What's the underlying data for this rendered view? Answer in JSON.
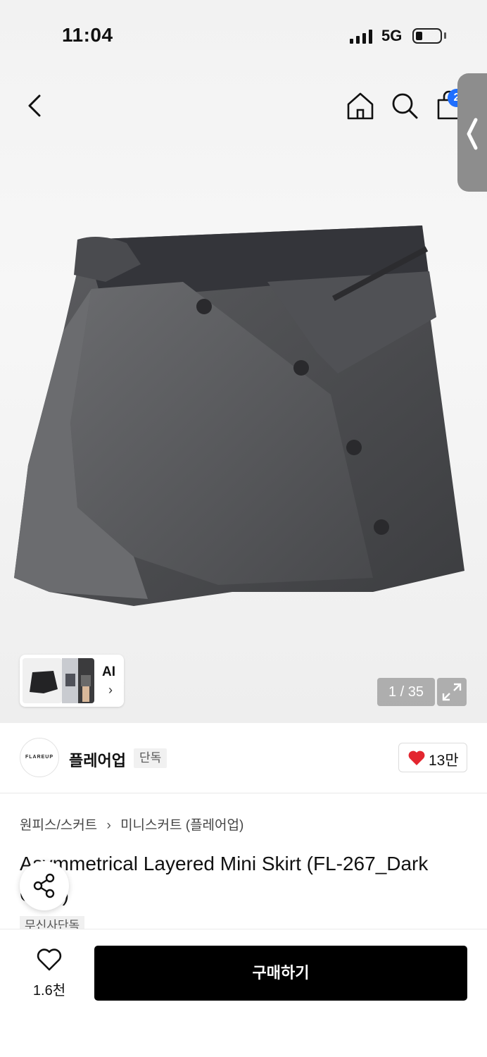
{
  "status_bar": {
    "time": "11:04",
    "network": "5G"
  },
  "nav": {
    "cart_count": "2"
  },
  "gallery": {
    "ai_label": "AI",
    "ai_chevron": "›",
    "counter": "1 / 35"
  },
  "brand": {
    "logo_text": "FLAREUP",
    "name": "플레어업",
    "tag": "단독",
    "likes": "13만"
  },
  "breadcrumb": {
    "category": "원피스/스커트",
    "separator": "›",
    "subcategory": "미니스커트 (플레어업)"
  },
  "product": {
    "title": "Asymmetrical Layered Mini Skirt (FL-267_Dark Gray)",
    "badge": "무신사단독"
  },
  "bottom_bar": {
    "wish_count": "1.6천",
    "buy_label": "구매하기"
  },
  "colors": {
    "accent_blue": "#1f6fff",
    "heart_red": "#e3262f",
    "buy_button": "#000000"
  },
  "icons": [
    "back-arrow-icon",
    "home-icon",
    "search-icon",
    "cart-icon",
    "chevron-left-icon",
    "expand-icon",
    "heart-icon",
    "share-icon"
  ]
}
